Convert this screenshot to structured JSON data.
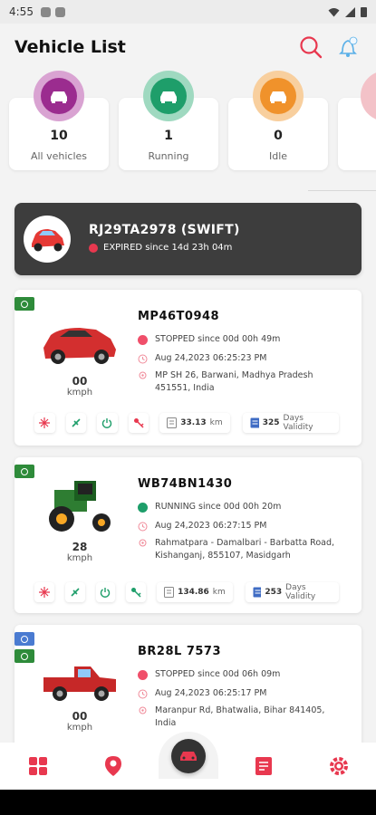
{
  "statusbar": {
    "time": "4:55"
  },
  "header": {
    "title": "Vehicle List",
    "notif_badge": "0"
  },
  "stats": [
    {
      "count": "10",
      "label": "All vehicles",
      "color": "#9b2c8f",
      "ring": "#d9a3d2"
    },
    {
      "count": "1",
      "label": "Running",
      "color": "#1e9e6a",
      "ring": "#9fd9c0"
    },
    {
      "count": "0",
      "label": "Idle",
      "color": "#f0922b",
      "ring": "#f8cf9e"
    }
  ],
  "banner": {
    "title": "RJ29TA2978 (SWIFT)",
    "status": "EXPIRED since  14d 23h 04m",
    "status_color": "#e8384f"
  },
  "vehicles": [
    {
      "plate": "MP46T0948",
      "status": "STOPPED since  00d 00h 49m",
      "status_color": "#f04f6a",
      "time": "Aug 24,2023 06:25:23 PM",
      "address": "MP SH 26, Barwani, Madhya Pradesh 451551, India",
      "speed": "00",
      "speed_unit": "kmph",
      "km": "33.13",
      "km_unit": "km",
      "days": "325",
      "days_label": "Days Validity",
      "type": "car"
    },
    {
      "plate": "WB74BN1430",
      "status": "RUNNING since  00d 00h 20m",
      "status_color": "#1e9e6a",
      "time": "Aug 24,2023 06:27:15 PM",
      "address": "Rahmatpara - Damalbari - Barbatta Road, Kishanganj, 855107, Masidgarh",
      "speed": "28",
      "speed_unit": "kmph",
      "km": "134.86",
      "km_unit": "km",
      "days": "253",
      "days_label": "Days Validity",
      "type": "tractor"
    },
    {
      "plate": "BR28L 7573",
      "status": "STOPPED since  00d 06h 09m",
      "status_color": "#f04f6a",
      "time": "Aug 24,2023 06:25:17 PM",
      "address": "Maranpur Rd, Bhatwalia, Bihar 841405, India",
      "speed": "00",
      "speed_unit": "kmph",
      "type": "pickup"
    }
  ],
  "colors": {
    "accent": "#e8384f",
    "dark": "#333333"
  }
}
